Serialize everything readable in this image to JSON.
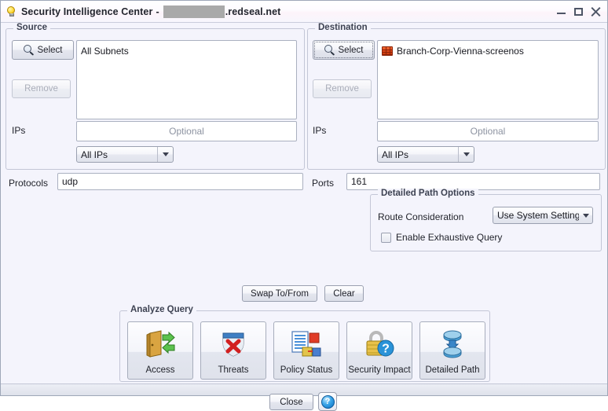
{
  "window": {
    "title_prefix": "Security Intelligence Center",
    "title_separator": "-",
    "title_suffix": ".redseal.net",
    "app_icon": "lightbulb-icon",
    "redacted_host": "",
    "controls": {
      "minimize": "minimize-icon",
      "maximize": "maximize-icon",
      "close": "close-icon"
    }
  },
  "source": {
    "legend": "Source",
    "select_label": "Select",
    "select_icon": "magnifier-icon",
    "remove_label": "Remove",
    "items": [
      {
        "label": "All Subnets",
        "icon": ""
      }
    ],
    "ips_label": "IPs",
    "ips_value": "",
    "ips_placeholder": "Optional",
    "ip_scope_value": "All IPs",
    "ip_scope_options": [
      "All IPs"
    ]
  },
  "destination": {
    "legend": "Destination",
    "select_label": "Select",
    "select_icon": "magnifier-icon",
    "remove_label": "Remove",
    "items": [
      {
        "label": "Branch-Corp-Vienna-screenos",
        "icon": "firewall-brick-icon"
      }
    ],
    "ips_label": "IPs",
    "ips_value": "",
    "ips_placeholder": "Optional",
    "ip_scope_value": "All IPs",
    "ip_scope_options": [
      "All IPs"
    ]
  },
  "query": {
    "protocols_label": "Protocols",
    "protocols_value": "udp",
    "ports_label": "Ports",
    "ports_value": "161"
  },
  "detailed_path_options": {
    "legend": "Detailed Path Options",
    "route_consideration_label": "Route Consideration",
    "route_consideration_value": "Use System Settings",
    "route_consideration_options": [
      "Use System Settings"
    ],
    "exhaustive_label": "Enable Exhaustive Query",
    "exhaustive_checked": false
  },
  "actions": {
    "swap_label": "Swap To/From",
    "clear_label": "Clear"
  },
  "analyze": {
    "legend": "Analyze Query",
    "buttons": [
      {
        "label": "Access",
        "icon": "door-arrows-icon"
      },
      {
        "label": "Threats",
        "icon": "shield-x-icon"
      },
      {
        "label": "Policy Status",
        "icon": "policy-document-icon"
      },
      {
        "label": "Security Impact",
        "icon": "padlock-question-icon"
      },
      {
        "label": "Detailed Path",
        "icon": "path-cylinders-icon"
      }
    ]
  },
  "footer": {
    "close_label": "Close",
    "help_label": "?",
    "help_icon": "help-icon"
  },
  "colors": {
    "window_bg": "#f4f4fc",
    "group_border": "#c3c6d6",
    "field_border": "#aab0c0",
    "text": "#22242c",
    "accent_red": "#d63b17",
    "accent_blue": "#2a8fd8",
    "accent_green": "#3faa3a",
    "redaction": "#a9a9a9"
  }
}
